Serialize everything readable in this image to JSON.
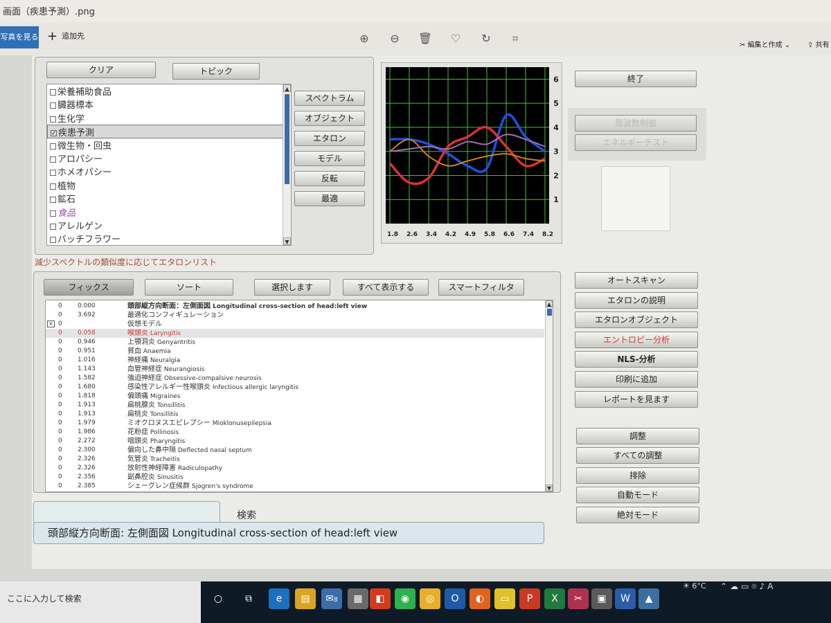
{
  "viewer": {
    "title": "画面（疾患予測）.png",
    "open_photos": "写真を見る",
    "add_to": "追加先",
    "edit_create": "編集と作成",
    "share": "共有"
  },
  "topic_panel": {
    "clear": "クリア",
    "topic": "トピック",
    "items": [
      {
        "label": "栄養補助食品",
        "checked": false
      },
      {
        "label": "臓器標本",
        "checked": false
      },
      {
        "label": "生化学",
        "checked": false
      },
      {
        "label": "疾患予測",
        "checked": true
      },
      {
        "label": "微生物・回虫",
        "checked": false
      },
      {
        "label": "アロパシー",
        "checked": false
      },
      {
        "label": "ホメオパシー",
        "checked": false
      },
      {
        "label": "植物",
        "checked": false
      },
      {
        "label": "鉱石",
        "checked": false
      },
      {
        "label": "食品",
        "checked": false
      },
      {
        "label": "アレルゲン",
        "checked": false
      },
      {
        "label": "バッチフラワー",
        "checked": false
      }
    ],
    "side_buttons": [
      "スペクトラム",
      "オブジェクト",
      "エタロン",
      "モデル",
      "反転",
      "最適"
    ]
  },
  "chart_data": {
    "type": "line",
    "x_ticks": [
      "1.8",
      "2.6",
      "3.4",
      "4.2",
      "4.9",
      "5.8",
      "6.6",
      "7.4",
      "8.2"
    ],
    "y_ticks": [
      "1",
      "2",
      "3",
      "4",
      "5",
      "6"
    ],
    "ylim": [
      0,
      6.5
    ],
    "background": "#000000",
    "grid_color": "#3cc83c",
    "series": [
      {
        "color": "#2050e0",
        "values": [
          3.5,
          3.5,
          3.3,
          2.9,
          2.4,
          2.3,
          4.5,
          3.6,
          3.0
        ]
      },
      {
        "color": "#e03030",
        "values": [
          2.5,
          1.7,
          1.9,
          3.2,
          3.6,
          4.0,
          3.2,
          2.4,
          2.7
        ]
      },
      {
        "color": "#d08020",
        "values": [
          3.0,
          3.5,
          2.8,
          2.4,
          2.6,
          2.8,
          2.9,
          2.7,
          2.6
        ]
      },
      {
        "color": "#a070b0",
        "values": [
          3.0,
          3.1,
          3.2,
          3.1,
          3.4,
          3.3,
          3.7,
          3.5,
          3.2
        ]
      }
    ]
  },
  "right_buttons": {
    "exit": "終了",
    "disabled1": "周波数制御",
    "disabled2": "エネルギーテスト",
    "group1": [
      "オートスキャン",
      "エタロンの説明",
      "エタロンオブジェクト",
      "エントロピー分析",
      "NLS-分析",
      "印刷に追加",
      "レポートを見ます"
    ],
    "group2": [
      "調整",
      "すべての調整",
      "排除",
      "自動モード",
      "絶対モード"
    ]
  },
  "results": {
    "section_label": "減少スペクトルの類似度に応じてエタロンリスト",
    "buttons": [
      "フィックス",
      "ソート",
      "選択します",
      "すべて表示する",
      "スマートフィルタ"
    ],
    "rows": [
      {
        "mark": "",
        "n": "0",
        "value": "0.000",
        "jp": "頭部縦方向断面：左側面図",
        "en": "Longitudinal cross-section of head:left view"
      },
      {
        "mark": "",
        "n": "0",
        "value": "3.692",
        "jp": "最適化コンフィギュレーション",
        "en": ""
      },
      {
        "mark": "×",
        "n": "0",
        "value": "",
        "jp": "仮想モデル",
        "en": ""
      },
      {
        "mark": "",
        "n": "0",
        "value": "0.058",
        "jp": "喉頭炎",
        "en": "Laryngitis"
      },
      {
        "mark": "",
        "n": "0",
        "value": "0.946",
        "jp": "上顎洞炎",
        "en": "Genyantritis"
      },
      {
        "mark": "",
        "n": "0",
        "value": "0.951",
        "jp": "貧血",
        "en": "Anaemia"
      },
      {
        "mark": "",
        "n": "0",
        "value": "1.016",
        "jp": "神経痛",
        "en": "Neuralgia"
      },
      {
        "mark": "",
        "n": "0",
        "value": "1.143",
        "jp": "血管神経症",
        "en": "Neurangiosis"
      },
      {
        "mark": "",
        "n": "0",
        "value": "1.582",
        "jp": "強迫神経症",
        "en": "Obsessive-compalsive neurosis"
      },
      {
        "mark": "",
        "n": "0",
        "value": "1.680",
        "jp": "感染性アレルギー性喉頭炎",
        "en": "Infectious allergic laryngitis"
      },
      {
        "mark": "",
        "n": "0",
        "value": "1.818",
        "jp": "偏頭痛",
        "en": "Migraines"
      },
      {
        "mark": "",
        "n": "0",
        "value": "1.913",
        "jp": "扁桃腺炎",
        "en": "Tonsillitis"
      },
      {
        "mark": "",
        "n": "0",
        "value": "1.913",
        "jp": "扁桃炎",
        "en": "Tonsillitis"
      },
      {
        "mark": "",
        "n": "0",
        "value": "1.979",
        "jp": "ミオクロヌスエピレプシー",
        "en": "Mioklonusepilepsia"
      },
      {
        "mark": "",
        "n": "0",
        "value": "1.986",
        "jp": "花粉症",
        "en": "Pollinosis"
      },
      {
        "mark": "",
        "n": "0",
        "value": "2.272",
        "jp": "咽頭炎",
        "en": "Pharyngitis"
      },
      {
        "mark": "",
        "n": "0",
        "value": "2.300",
        "jp": "偏向した鼻中隔",
        "en": "Deflected nasal septum"
      },
      {
        "mark": "",
        "n": "0",
        "value": "2.326",
        "jp": "気管炎",
        "en": "Tracheitis"
      },
      {
        "mark": "",
        "n": "0",
        "value": "2.326",
        "jp": "放射性神経障害",
        "en": "Radiculopathy"
      },
      {
        "mark": "",
        "n": "0",
        "value": "2.356",
        "jp": "副鼻腔炎",
        "en": "Sinusitis"
      },
      {
        "mark": "",
        "n": "0",
        "value": "2.385",
        "jp": "シェーグレン症候群",
        "en": "Sjogren's syndrome"
      }
    ],
    "search_label": "検索",
    "status": "頭部縦方向断面: 左側面図 Longitudinal cross-section of head:left view"
  },
  "taskbar": {
    "search_placeholder": "ここに入力して検索",
    "temperature": "6°C",
    "mail_badge": "8"
  }
}
